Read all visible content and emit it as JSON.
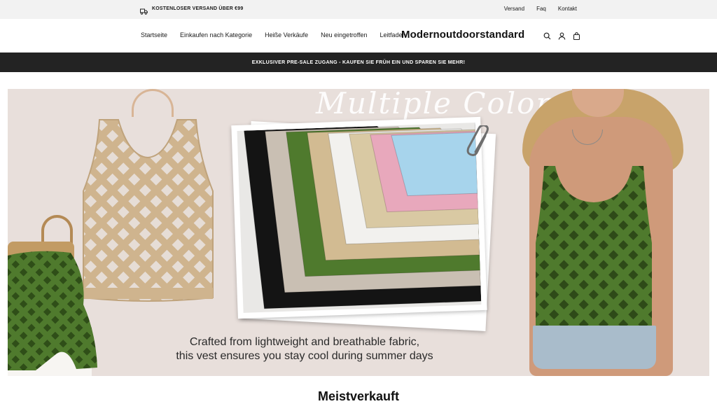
{
  "topbar": {
    "shipping_icon": "truck-icon",
    "shipping_text": "KOSTENLOSER VERSAND ÜBER €99",
    "links": [
      "Versand",
      "Faq",
      "Kontakt"
    ]
  },
  "header": {
    "nav": [
      "Startseite",
      "Einkaufen nach Kategorie",
      "Heiße Verkäufe",
      "Neu eingetroffen",
      "Leitfaden"
    ],
    "logo": "Modernoutdoorstandard",
    "icons": [
      "search-icon",
      "user-icon",
      "bag-icon"
    ]
  },
  "announcement": {
    "text": "EXKLUSIVER PRE-SALE ZUGANG - KAUFEN SIE FRÜH EIN UND SPAREN SIE MEHR!"
  },
  "hero": {
    "title": "Multiple Colors",
    "caption_line1": "Crafted from lightweight and breathable fabric,",
    "caption_line2": "this vest ensures you stay cool during summer days",
    "swatch_colors": [
      "#141414",
      "#c9bfb3",
      "#4f7a2d",
      "#d2bb92",
      "#f2f1ee",
      "#d9c9a3",
      "#e8a8bc",
      "#a7d4ec"
    ],
    "tank_beige": "#cfb48e",
    "tank_green": "#4f7a2d"
  },
  "section": {
    "title": "Meistverkauft"
  }
}
